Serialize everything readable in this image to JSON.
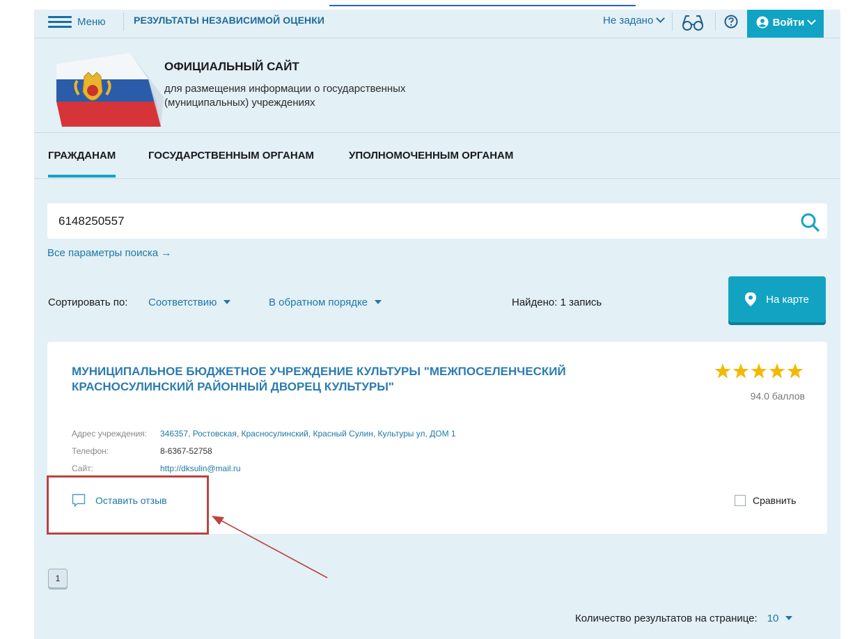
{
  "document": {
    "text_fragment": ""
  },
  "topbar": {
    "menu_label": "Меню",
    "section_title": "РЕЗУЛЬТАТЫ НЕЗАВИСИМОЙ ОЦЕНКИ",
    "region_selector": "Не задано",
    "login_label": "Войти"
  },
  "header": {
    "title": "ОФИЦИАЛЬНЫЙ САЙТ",
    "subtitle": "для размещения информации о государственных (муниципальных) учреждениях"
  },
  "nav": {
    "tabs": [
      {
        "label": "ГРАЖДАНАМ",
        "active": true
      },
      {
        "label": "ГОСУДАРСТВЕННЫМ ОРГАНАМ",
        "active": false
      },
      {
        "label": "УПОЛНОМОЧЕННЫМ ОРГАНАМ",
        "active": false
      }
    ]
  },
  "search": {
    "value": "6148250557",
    "advanced_link": "Все параметры поиска →"
  },
  "sort": {
    "label": "Сортировать по:",
    "field": "Соответствию",
    "order": "В обратном порядке",
    "found": "Найдено: 1 запись",
    "map_button": "На карте"
  },
  "result": {
    "name": "МУНИЦИПАЛЬНОЕ БЮДЖЕТНОЕ УЧРЕЖДЕНИЕ КУЛЬТУРЫ \"МЕЖПОСЕЛЕНЧЕСКИЙ КРАСНОСУЛИНСКИЙ РАЙОННЫЙ ДВОРЕЦ КУЛЬТУРЫ\"",
    "rating_stars": 5,
    "score": "94.0 баллов",
    "address_label": "Адрес учреждения:",
    "address": "346357, Ростовская, Красносулинский, Красный Сулин, Культуры ул, ДОМ 1",
    "phone_label": "Телефон:",
    "phone": "8-6367-52758",
    "site_label": "Сайт:",
    "site": "http://dksulin@mail.ru",
    "review_label": "Оставить отзыв",
    "compare_label": "Сравнить"
  },
  "pagination": {
    "current_page": "1",
    "per_page_label": "Количество результатов на странице:",
    "per_page_value": "10"
  },
  "colors": {
    "accent": "#12a3c3",
    "link": "#2c7cb0",
    "background": "#e3f0f6",
    "star": "#f5b800",
    "annotation": "#b84540"
  }
}
